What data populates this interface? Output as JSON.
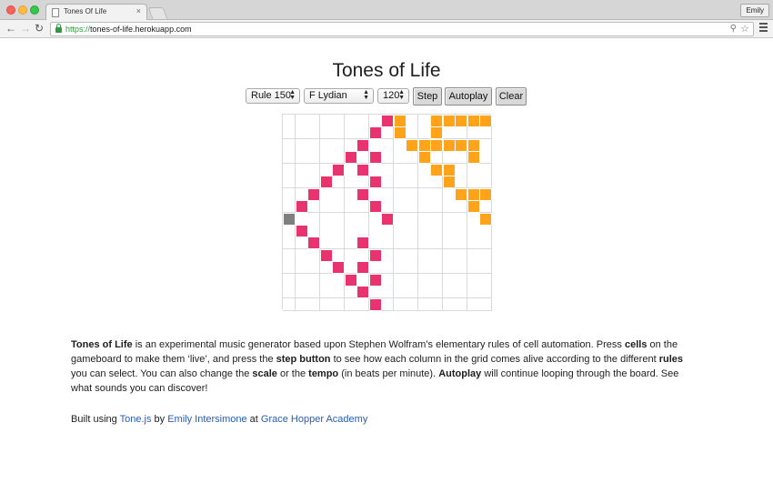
{
  "browser": {
    "tab_title": "Tones Of Life",
    "tab_close": "×",
    "url_scheme": "https://",
    "url_host": "tones-of-life.herokuapp.com",
    "profile_name": "Emily",
    "icons": [
      "back-arrow-icon",
      "forward-arrow-icon",
      "reload-icon",
      "lock-icon",
      "zoom-icon",
      "star-icon",
      "menu-icon"
    ]
  },
  "page": {
    "title": "Tones of Life"
  },
  "controls": {
    "rule_selected": "Rule 150",
    "scale_selected": "F Lydian",
    "tempo_selected": "120",
    "step_label": "Step",
    "autoplay_label": "Autoplay",
    "clear_label": "Clear"
  },
  "gameboard": {
    "columns": 17,
    "rows": 16,
    "colors": {
      "pink": "#e8336f",
      "orange": "#ffa31a",
      "gray": "#7f7f7f",
      "empty": "#ffffff",
      "gridline": "#d9d9d9"
    },
    "pink_cells": [
      [
        0,
        8
      ],
      [
        1,
        7
      ],
      [
        2,
        6
      ],
      [
        3,
        5
      ],
      [
        3,
        7
      ],
      [
        4,
        4
      ],
      [
        4,
        6
      ],
      [
        5,
        3
      ],
      [
        5,
        7
      ],
      [
        6,
        2
      ],
      [
        6,
        6
      ],
      [
        7,
        1
      ],
      [
        7,
        7
      ],
      [
        8,
        0
      ],
      [
        8,
        8
      ],
      [
        9,
        1
      ],
      [
        10,
        2
      ],
      [
        10,
        6
      ],
      [
        11,
        3
      ],
      [
        11,
        7
      ],
      [
        12,
        4
      ],
      [
        12,
        6
      ],
      [
        13,
        5
      ],
      [
        13,
        7
      ],
      [
        14,
        6
      ],
      [
        15,
        7
      ]
    ],
    "orange_cells": [
      [
        0,
        9
      ],
      [
        0,
        12
      ],
      [
        0,
        13
      ],
      [
        0,
        14
      ],
      [
        0,
        15
      ],
      [
        0,
        16
      ],
      [
        1,
        9
      ],
      [
        1,
        12
      ],
      [
        2,
        10
      ],
      [
        2,
        11
      ],
      [
        2,
        12
      ],
      [
        2,
        13
      ],
      [
        2,
        14
      ],
      [
        2,
        15
      ],
      [
        3,
        11
      ],
      [
        3,
        15
      ],
      [
        4,
        12
      ],
      [
        4,
        13
      ],
      [
        5,
        13
      ],
      [
        6,
        14
      ],
      [
        6,
        15
      ],
      [
        6,
        16
      ],
      [
        7,
        15
      ],
      [
        8,
        16
      ]
    ],
    "gray_cells": [
      [
        8,
        0
      ]
    ]
  },
  "description": {
    "b1": "Tones of Life",
    "t1": " is an experimental music generator based upon Stephen Wolfram’s elementary rules of cell automation. Press ",
    "b2": "cells",
    "t2": " on the gameboard to make them ‘live’, and press the ",
    "b3": "step button",
    "t3": " to see how each column in the grid comes alive according to the different ",
    "b4": "rules",
    "t4": " you can select. You can also change the ",
    "b5": "scale",
    "t5": " or the ",
    "b6": "tempo",
    "t6": " (in beats per minute). ",
    "b7": "Autoplay",
    "t7": " will continue looping through the board. See what sounds you can discover!"
  },
  "footer": {
    "built_using": "Built using ",
    "tonejs_link": "Tone.js",
    "by": " by ",
    "author_link": "Emily Intersimone",
    "at": " at ",
    "academy_link": "Grace Hopper Academy"
  }
}
